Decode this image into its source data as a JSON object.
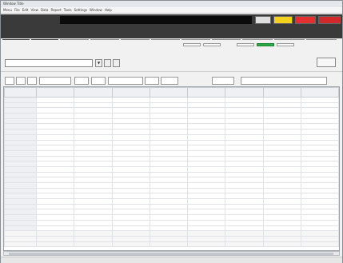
{
  "window": {
    "title": "Window Title"
  },
  "menubar": [
    "Menu",
    "File",
    "Edit",
    "View",
    "Data",
    "Report",
    "Tools",
    "Settings",
    "Window",
    "Help"
  ],
  "topbar": {
    "status": {
      "gray": "",
      "yellow": "",
      "red1": "",
      "red2": ""
    },
    "nav": [
      "",
      "",
      "",
      "",
      "",
      "",
      "",
      "",
      "",
      "",
      ""
    ]
  },
  "header": {
    "title": "",
    "buttons": [
      "",
      "",
      "",
      "",
      ""
    ]
  },
  "filter1": {
    "label": "",
    "select_value": "",
    "small1": "▼",
    "small2": "",
    "small3": "",
    "center_title": "",
    "right_button": ""
  },
  "filter2": {
    "label": "",
    "buttons": [
      "",
      "",
      "",
      "",
      "",
      "",
      "",
      "",
      "",
      "",
      "",
      ""
    ]
  },
  "table": {
    "columns": [
      "",
      "",
      "",
      "",
      "",
      "",
      "",
      "",
      ""
    ],
    "rows": [
      {
        "label": "",
        "cells": [
          "",
          "",
          "",
          "",
          "",
          "",
          "",
          ""
        ]
      },
      {
        "label": "",
        "cells": [
          "",
          "",
          "",
          "",
          "",
          "",
          "",
          ""
        ]
      },
      {
        "label": "",
        "cells": [
          "",
          "",
          "",
          "",
          "",
          "",
          "",
          ""
        ]
      },
      {
        "label": "",
        "cells": [
          "",
          "",
          "",
          "",
          "",
          "",
          "",
          ""
        ]
      },
      {
        "label": "",
        "cells": [
          "",
          "",
          "",
          "",
          "",
          "",
          "",
          ""
        ]
      },
      {
        "label": "",
        "cells": [
          "",
          "",
          "",
          "",
          "",
          "",
          "",
          ""
        ]
      },
      {
        "label": "",
        "cells": [
          "",
          "",
          "",
          "",
          "",
          "",
          "",
          ""
        ]
      },
      {
        "label": "",
        "cells": [
          "",
          "",
          "",
          "",
          "",
          "",
          "",
          ""
        ]
      },
      {
        "label": "",
        "cells": [
          "",
          "",
          "",
          "",
          "",
          "",
          "",
          ""
        ]
      },
      {
        "label": "",
        "cells": [
          "",
          "",
          "",
          "",
          "",
          "",
          "",
          ""
        ]
      },
      {
        "label": "",
        "cells": [
          "",
          "",
          "",
          "",
          "",
          "",
          "",
          ""
        ]
      },
      {
        "label": "",
        "cells": [
          "",
          "",
          "",
          "",
          "",
          "",
          "",
          ""
        ]
      },
      {
        "label": "",
        "cells": [
          "",
          "",
          "",
          "",
          "",
          "",
          "",
          ""
        ]
      },
      {
        "label": "",
        "cells": [
          "",
          "",
          "",
          "",
          "",
          "",
          "",
          ""
        ]
      },
      {
        "label": "",
        "cells": [
          "",
          "",
          "",
          "",
          "",
          "",
          "",
          ""
        ]
      },
      {
        "label": "",
        "cells": [
          "",
          "",
          "",
          "",
          "",
          "",
          "",
          ""
        ]
      },
      {
        "label": "",
        "cells": [
          "",
          "",
          "",
          "",
          "",
          "",
          "",
          ""
        ]
      },
      {
        "label": "",
        "cells": [
          "",
          "",
          "",
          "",
          "",
          "",
          "",
          ""
        ]
      },
      {
        "label": "",
        "cells": [
          "",
          "",
          "",
          "",
          "",
          "",
          "",
          ""
        ]
      },
      {
        "label": "",
        "cells": [
          "",
          "",
          "",
          "",
          "",
          "",
          "",
          ""
        ]
      },
      {
        "label": "",
        "cells": [
          "",
          "",
          "",
          "",
          "",
          "",
          "",
          ""
        ]
      },
      {
        "label": "",
        "cells": [
          "",
          "",
          "",
          "",
          "",
          "",
          "",
          ""
        ]
      },
      {
        "label": "",
        "cells": [
          "",
          "",
          "",
          "",
          "",
          "",
          "",
          ""
        ]
      },
      {
        "label": "",
        "cells": [
          "",
          "",
          "",
          "",
          "",
          "",
          "",
          ""
        ]
      },
      {
        "label": "",
        "cells": [
          "",
          "",
          "",
          "",
          "",
          "",
          "",
          ""
        ]
      }
    ],
    "totals": [
      {
        "label": "",
        "cells": [
          "",
          "",
          "",
          "",
          "",
          "",
          "",
          ""
        ]
      },
      {
        "label": "",
        "cells": [
          "",
          "",
          "",
          "",
          "",
          "",
          "",
          ""
        ]
      },
      {
        "label": "",
        "cells": [
          "",
          "",
          "",
          "",
          "",
          "",
          "",
          ""
        ]
      }
    ]
  },
  "statusbar": {
    "left": "",
    "right": ""
  },
  "colors": {
    "accent_green": "#2aaa43",
    "yellow": "#f3d21b",
    "red": "#e23030",
    "title_blue": "#1a3c8f"
  }
}
